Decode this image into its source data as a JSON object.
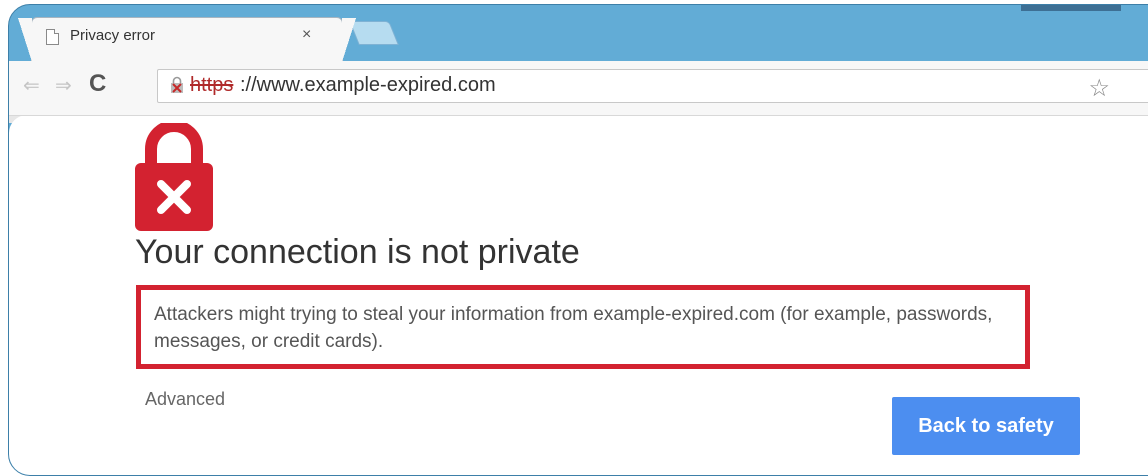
{
  "tab": {
    "title": "Privacy error",
    "close_glyph": "×"
  },
  "toolbar": {
    "back_glyph": "⇐",
    "forward_glyph": "⇒",
    "reload_glyph": "C",
    "url_scheme": "https",
    "url_rest": "://www.example-expired.com",
    "star_glyph": "☆"
  },
  "page": {
    "heading": "Your connection is not private",
    "explanation": "Attackers might trying to steal your information from example-expired.com (for example, passwords, messages, or credit cards).",
    "advanced_label": "Advanced",
    "back_button_label": "Back to safety"
  },
  "icons": {
    "tab_icon": "document-icon",
    "lock_icon": "broken-lock-icon",
    "padlock": "padlock-x-icon",
    "star": "star-icon"
  },
  "colors": {
    "frame": "#62acd6",
    "danger": "#d32230",
    "button": "#4c8ef0"
  }
}
